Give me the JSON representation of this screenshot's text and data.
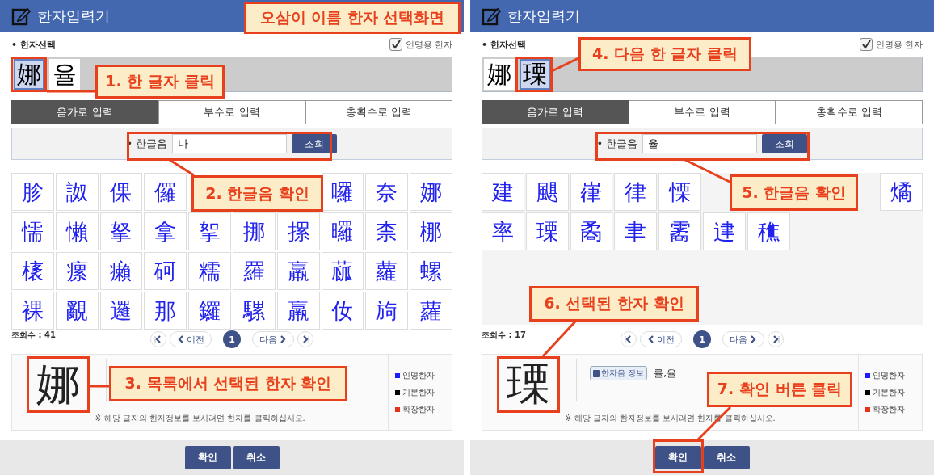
{
  "screens": [
    {
      "header": {
        "title": "한자입력기"
      },
      "section_label": "• 한자선택",
      "name_checkbox": {
        "label": "인명용 한자",
        "checked": true
      },
      "selected_chars": [
        {
          "char": "娜",
          "selected": true
        },
        {
          "char": "율",
          "selected": false
        }
      ],
      "tabs": [
        {
          "label": "음가로 입력",
          "selected": true
        },
        {
          "label": "부수로 입력",
          "selected": false
        },
        {
          "label": "총획수로 입력",
          "selected": false
        }
      ],
      "search": {
        "label": "• 한글음",
        "value": "나",
        "button": "조회"
      },
      "results": {
        "rows": [
          [
            "胗",
            "詉",
            "倮",
            "儸",
            null,
            null,
            null,
            "囉",
            "奈",
            "娜"
          ],
          [
            "懦",
            "懶",
            "拏",
            "拿",
            "挐",
            "挪",
            "摞",
            "曪",
            "柰",
            "梛"
          ],
          [
            "橠",
            "瘰",
            "癩",
            "砢",
            "糯",
            "羅",
            "羸",
            "蓏",
            "蘿",
            "螺"
          ],
          [
            "裸",
            "覶",
            "邏",
            "那",
            "鑼",
            "騾",
            "羸",
            "㚢",
            "㫊",
            "蘿"
          ]
        ]
      },
      "count": "조회수 : 41",
      "pager": {
        "prev": "이전",
        "page": "1",
        "next": "다음"
      },
      "detail": {
        "char": "娜",
        "note": "※ 해당 글자의 한자정보를 보시려면 한자를 클릭하십시오.",
        "legend": [
          {
            "label": "인명한자",
            "color": "#1a1aff"
          },
          {
            "label": "기본한자",
            "color": "#000000"
          },
          {
            "label": "확장한자",
            "color": "#e8301c"
          }
        ]
      },
      "buttons": [
        {
          "label": "확인"
        },
        {
          "label": "취소"
        }
      ],
      "annotations": [
        {
          "text": "오삼이 이름 한자 선택화면"
        },
        {
          "text": "1. 한 글자 클릭"
        },
        {
          "text": "2. 한글음 확인"
        },
        {
          "text": "3. 목록에서 선택된 한자 확인"
        }
      ]
    },
    {
      "header": {
        "title": "한자입력기"
      },
      "section_label": "• 한자선택",
      "name_checkbox": {
        "label": "인명용 한자",
        "checked": true
      },
      "selected_chars": [
        {
          "char": "娜",
          "selected": false
        },
        {
          "char": "瑮",
          "selected": true
        }
      ],
      "tabs": [
        {
          "label": "음가로 입력",
          "selected": true
        },
        {
          "label": "부수로 입력",
          "selected": false
        },
        {
          "label": "총획수로 입력",
          "selected": false
        }
      ],
      "search": {
        "label": "• 한글음",
        "value": "율",
        "button": "조회"
      },
      "results": {
        "rows": [
          [
            "建",
            "颶",
            "嵂",
            "律",
            "慄",
            null,
            null,
            null,
            null,
            "燏"
          ],
          [
            "率",
            "瑮",
            "矞",
            "聿",
            "霱",
            "䢖",
            "穛"
          ]
        ]
      },
      "count": "조회수 : 17",
      "pager": {
        "prev": "이전",
        "page": "1",
        "next": "다음"
      },
      "detail": {
        "char": "瑮",
        "info": {
          "badge": "한자음 정보",
          "reading": "률,율"
        },
        "note": "※ 해당 글자의 한자정보를 보시려면 한자를 클릭하십시오.",
        "legend": [
          {
            "label": "인명한자",
            "color": "#1a1aff"
          },
          {
            "label": "기본한자",
            "color": "#000000"
          },
          {
            "label": "확장한자",
            "color": "#e8301c"
          }
        ]
      },
      "buttons": [
        {
          "label": "확인"
        },
        {
          "label": "취소"
        }
      ],
      "annotations": [
        {
          "text": "4. 다음 한 글자 클릭"
        },
        {
          "text": "5. 한글음 확인"
        },
        {
          "text": "6. 선택된 한자 확인"
        },
        {
          "text": "7. 확인 버튼 클릭"
        }
      ]
    }
  ]
}
